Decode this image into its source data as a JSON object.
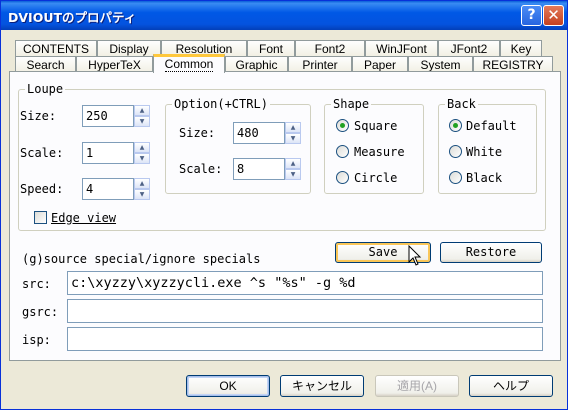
{
  "window": {
    "title": "DVIOUTのプロパティ",
    "help_glyph": "?",
    "close_glyph": "✕"
  },
  "tabs_row1": [
    "CONTENTS",
    "Display",
    "Resolution",
    "Font",
    "Font2",
    "WinJFont",
    "JFont2",
    "Key"
  ],
  "tabs_row2": [
    "Search",
    "HyperTeX",
    "Common",
    "Graphic",
    "Printer",
    "Paper",
    "System",
    "REGISTRY"
  ],
  "active_tab": "Common",
  "loupe": {
    "title": "Loupe",
    "size_label": "Size:",
    "size_value": "250",
    "scale_label": "Scale:",
    "scale_value": "1",
    "speed_label": "Speed:",
    "speed_value": "4",
    "edge_view_label": "Edge view",
    "edge_view_checked": false
  },
  "option": {
    "title": "Option(+CTRL)",
    "size_label": "Size:",
    "size_value": "480",
    "scale_label": "Scale:",
    "scale_value": "8"
  },
  "shape": {
    "title": "Shape",
    "options": [
      "Square",
      "Measure",
      "Circle"
    ],
    "selected": "Square"
  },
  "back": {
    "title": "Back",
    "options": [
      "Default",
      "White",
      "Black"
    ],
    "selected": "Default"
  },
  "source_section": {
    "heading": "(g)source special/ignore specials",
    "save_label": "Save",
    "restore_label": "Restore",
    "src_label": "src:",
    "src_value": "c:\\xyzzy\\xyzzycli.exe ^s \"%s\" -g %d",
    "gsrc_label": "gsrc:",
    "gsrc_value": "",
    "isp_label": "isp:",
    "isp_value": ""
  },
  "footer": {
    "ok": "OK",
    "cancel": "キャンセル",
    "apply": "適用(A)",
    "help": "ヘルプ"
  },
  "colors": {
    "titlebar": "#0058e6",
    "face": "#ece9d8",
    "panel": "#fcfcfe",
    "tab_highlight": "#ffc83c",
    "radio_dot": "#21a121"
  }
}
